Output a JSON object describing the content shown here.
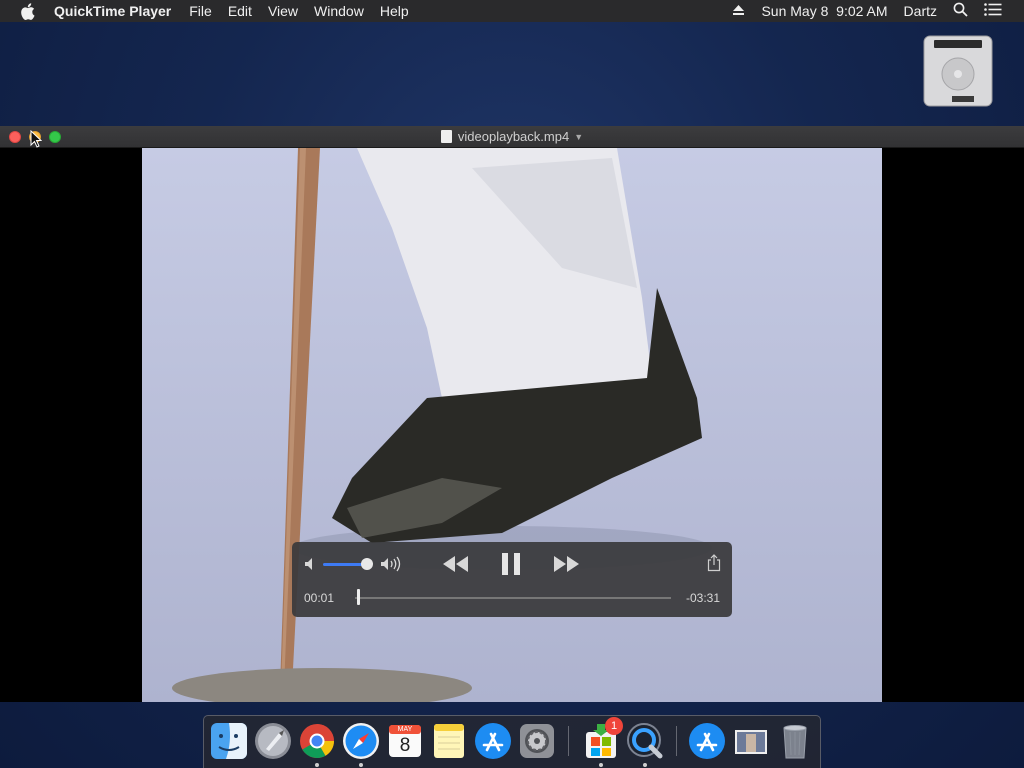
{
  "menubar": {
    "app_name": "QuickTime Player",
    "menus": [
      "File",
      "Edit",
      "View",
      "Window",
      "Help"
    ],
    "clock": "Sun May 8  9:02 AM",
    "user": "Dartz",
    "icons": [
      "apple-icon",
      "eject-icon",
      "search-icon",
      "list-icon"
    ]
  },
  "window": {
    "title": "videoplayback.mp4"
  },
  "player": {
    "elapsed": "00:01",
    "remaining": "-03:31",
    "volume": 0.85,
    "progress": 0.005,
    "accent": "#3e7bf5"
  },
  "dock": {
    "apps": [
      "finder",
      "launchpad",
      "chrome",
      "safari",
      "calendar",
      "notes",
      "app-store",
      "system-preferences",
      "microsoft-office",
      "quicktime",
      "app-store-folder",
      "photo-thumbnail",
      "trash"
    ],
    "calendar_month": "MAY",
    "calendar_day": "8",
    "badge_count": "1"
  }
}
